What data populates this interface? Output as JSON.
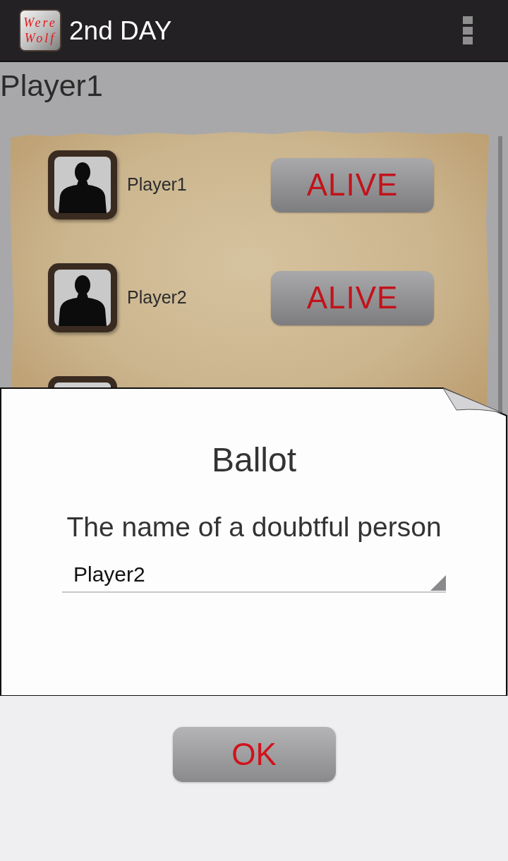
{
  "action_bar": {
    "logo": "Were Wolf",
    "title": "2nd DAY"
  },
  "heading": "Player1",
  "players": [
    {
      "name": "Player1",
      "button": "ALIVE",
      "covered": false
    },
    {
      "name": "Player2",
      "button": "ALIVE",
      "covered": false
    },
    {
      "covered": true
    }
  ],
  "dialog": {
    "title": "Ballot",
    "label": "The name of a doubtful person",
    "dropdown": {
      "value": "Player2"
    }
  },
  "buttons": [
    {
      "label": "OK"
    }
  ]
}
